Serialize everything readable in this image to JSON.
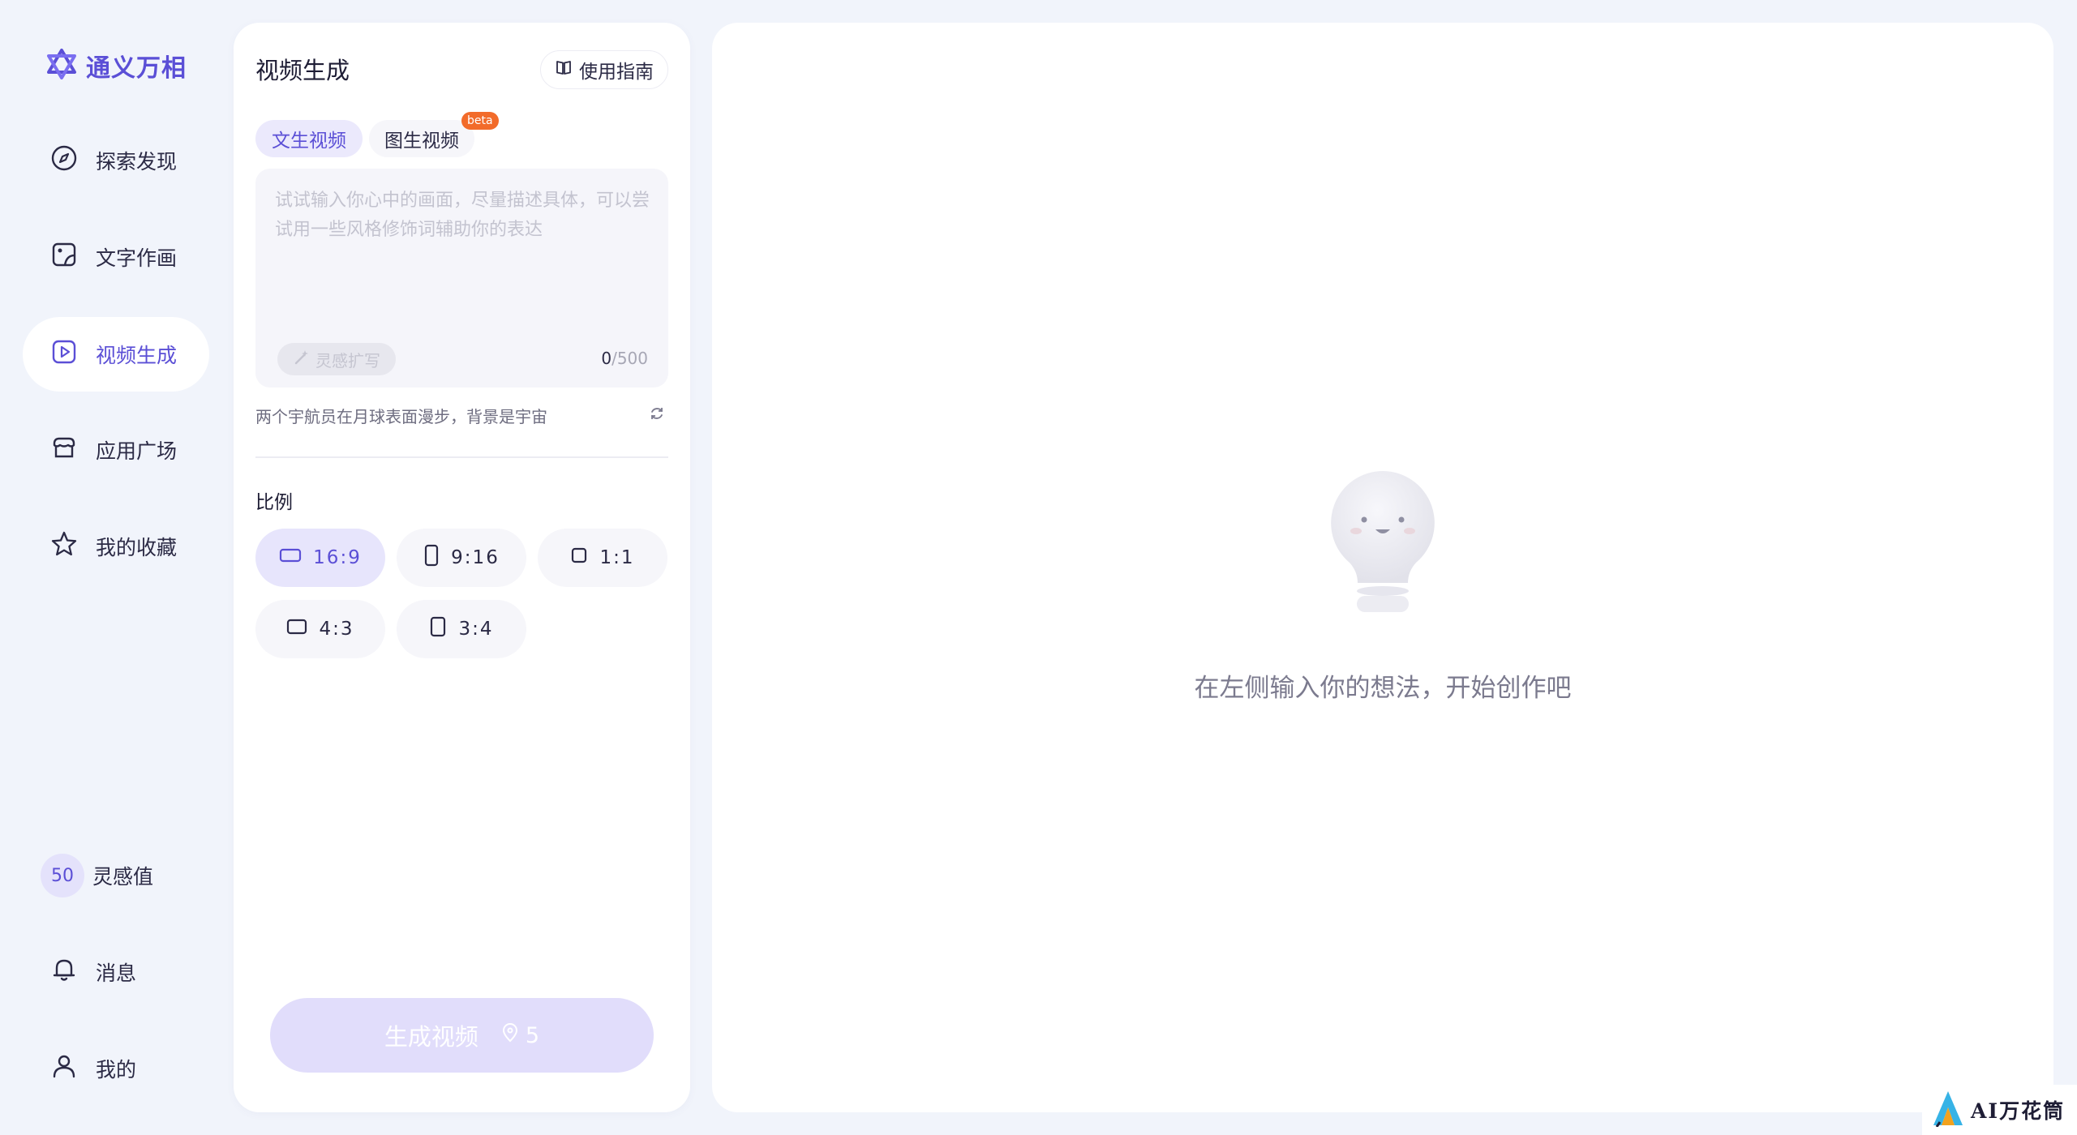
{
  "app": {
    "name": "通义万相",
    "brand_color": "#5b4fd6"
  },
  "nav": {
    "items": [
      {
        "label": "探索发现",
        "icon": "compass-icon"
      },
      {
        "label": "文字作画",
        "icon": "image-edit-icon"
      },
      {
        "label": "视频生成",
        "icon": "video-play-icon",
        "active": true
      },
      {
        "label": "应用广场",
        "icon": "store-icon"
      },
      {
        "label": "我的收藏",
        "icon": "star-icon"
      }
    ],
    "points": {
      "value": "50",
      "label": "灵感值"
    },
    "messages": "消息",
    "mine": "我的"
  },
  "panel": {
    "title": "视频生成",
    "guide_label": "使用指南",
    "tabs": [
      {
        "label": "文生视频",
        "active": true
      },
      {
        "label": "图生视频",
        "badge": "beta"
      }
    ],
    "prompt": {
      "value": "",
      "placeholder": "试试输入你心中的画面，尽量描述具体，可以尝试用一些风格修饰词辅助你的表达",
      "expand_label": "灵感扩写",
      "count_current": "0",
      "count_max": "/500"
    },
    "suggestion": "两个宇航员在月球表面漫步，背景是宇宙",
    "ratio_label": "比例",
    "ratios": [
      "16:9",
      "9:16",
      "1:1",
      "4:3",
      "3:4"
    ],
    "selected_ratio": "16:9",
    "generate": {
      "label": "生成视频",
      "cost": "5"
    }
  },
  "preview": {
    "empty_text": "在左侧输入你的想法，开始创作吧"
  },
  "watermark": {
    "text": "AI万花筒"
  }
}
